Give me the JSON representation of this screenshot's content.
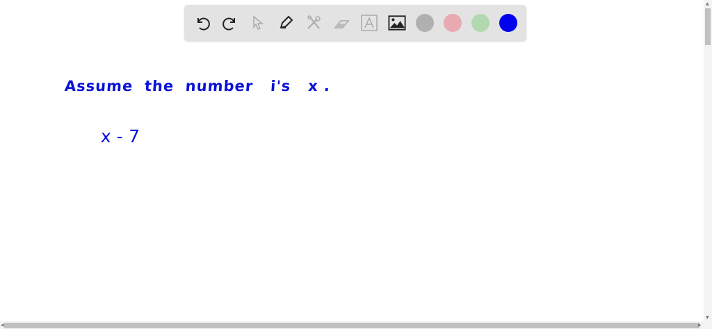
{
  "toolbar": {
    "tools": [
      "undo-icon",
      "redo-icon",
      "pointer-icon",
      "pen-icon",
      "tools-icon",
      "eraser-icon",
      "text-icon",
      "image-icon"
    ],
    "colors": {
      "gray": "#b0b0b0",
      "pink": "#e8a9b0",
      "green": "#b2d8b0",
      "blue": "#0000ee"
    },
    "selected_color": "blue"
  },
  "canvas": {
    "line1": "Assume  the  number   i's   x .",
    "line2": "x - 7"
  },
  "ink_color": "#0a12d8"
}
